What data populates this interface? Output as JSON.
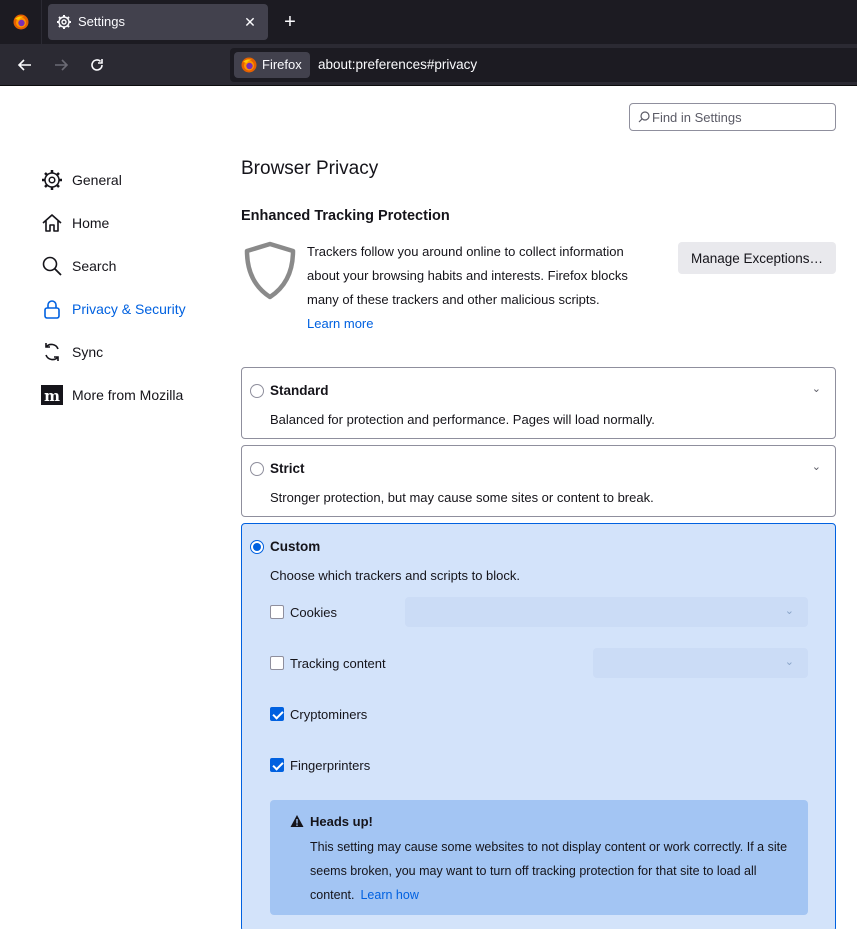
{
  "browser": {
    "tab_title": "Settings",
    "identity_label": "Firefox",
    "url": "about:preferences#privacy"
  },
  "search": {
    "placeholder": "Find in Settings"
  },
  "sidebar": {
    "items": [
      {
        "label": "General",
        "icon": "gear-icon"
      },
      {
        "label": "Home",
        "icon": "home-icon"
      },
      {
        "label": "Search",
        "icon": "search-icon"
      },
      {
        "label": "Privacy & Security",
        "icon": "lock-icon",
        "selected": true
      },
      {
        "label": "Sync",
        "icon": "sync-icon"
      },
      {
        "label": "More from Mozilla",
        "icon": "mozilla-icon"
      }
    ]
  },
  "main": {
    "page_title": "Browser Privacy",
    "etp_title": "Enhanced Tracking Protection",
    "etp_description": "Trackers follow you around online to collect information about your browsing habits and interests. Firefox blocks many of these trackers and other malicious scripts.",
    "learn_more": "Learn more",
    "manage_exceptions": "Manage Exceptions…",
    "options": {
      "standard": {
        "title": "Standard",
        "desc": "Balanced for protection and performance. Pages will load normally.",
        "checked": false
      },
      "strict": {
        "title": "Strict",
        "desc": "Stronger protection, but may cause some sites or content to break.",
        "checked": false
      },
      "custom": {
        "title": "Custom",
        "desc": "Choose which trackers and scripts to block.",
        "checked": true
      }
    },
    "custom_items": [
      {
        "label": "Cookies",
        "checked": false
      },
      {
        "label": "Tracking content",
        "checked": false
      },
      {
        "label": "Cryptominers",
        "checked": true
      },
      {
        "label": "Fingerprinters",
        "checked": true
      }
    ],
    "warning": {
      "title": "Heads up!",
      "body": "This setting may cause some websites to not display content or work correctly. If a site seems broken, you may want to turn off tracking protection for that site to load all content.",
      "learn_how": "Learn how"
    }
  },
  "colors": {
    "accent": "#0061e0",
    "custom_bg": "#d3e3fa",
    "warning_bg": "#a3c5f3",
    "toolbar_bg": "#2b2a33",
    "tabbar_bg": "#1c1b22"
  }
}
